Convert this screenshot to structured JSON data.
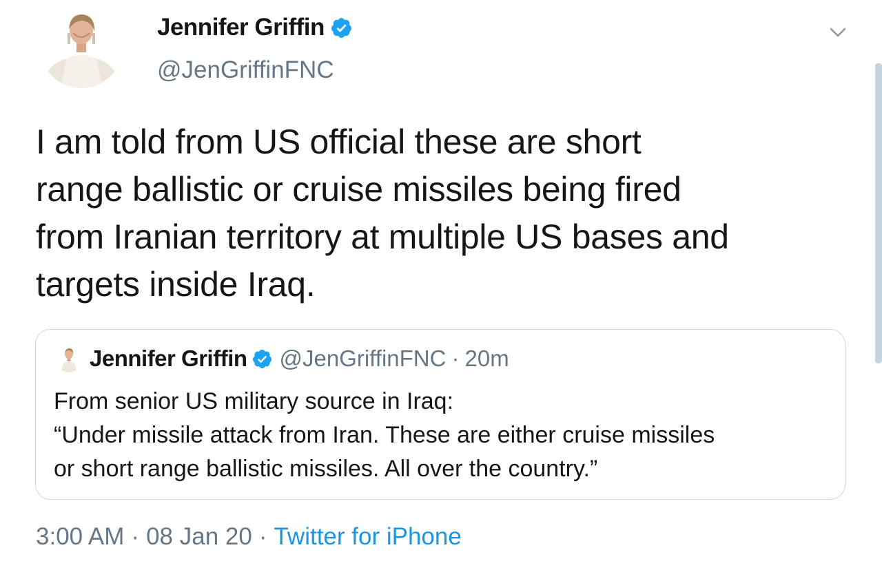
{
  "tweet": {
    "author": {
      "name": "Jennifer Griffin",
      "handle": "@JenGriffinFNC",
      "verified": true
    },
    "text": "I am told from US official these are short\nrange ballistic or cruise missiles being fired\nfrom Iranian territory at multiple US bases and\ntargets inside Iraq.",
    "quoted_tweet": {
      "author_name": "Jennifer Griffin",
      "author_handle": "@JenGriffinFNC",
      "separator": "·",
      "time_ago": "20m",
      "text": "From senior US military source in Iraq:\n“Under missile attack from Iran. These are either cruise missiles\nor short range ballistic missiles. All over the country.”"
    },
    "meta": {
      "time": "3:00 AM",
      "separator": "·",
      "date": "08 Jan 20",
      "source": "Twitter for iPhone"
    }
  },
  "icons": {
    "verified": "verified-badge-icon",
    "menu": "chevron-down-icon"
  },
  "colors": {
    "verified": "#1da1f2",
    "secondary_text": "#657786",
    "link": "#1b95e0",
    "border": "#ccd6dd",
    "primary_text": "#14171a"
  }
}
